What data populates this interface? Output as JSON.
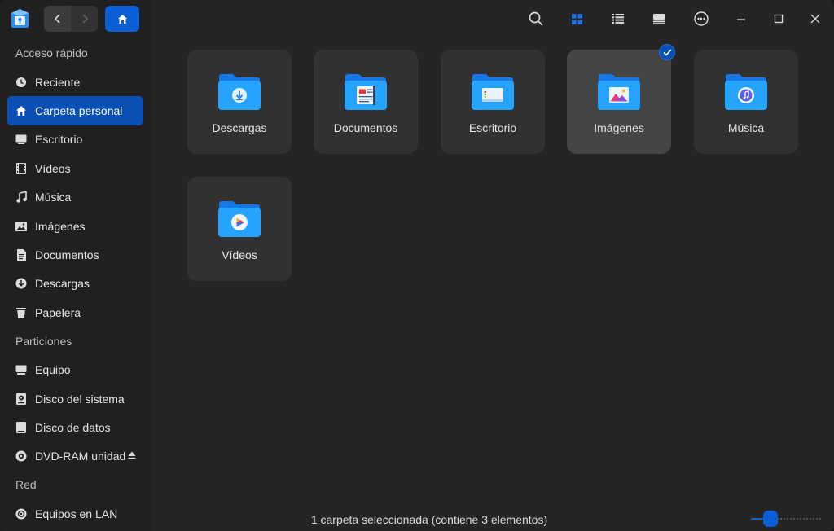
{
  "nav": {
    "back_icon": "chevron-left-icon",
    "forward_icon": "chevron-right-icon",
    "home_icon": "home-icon"
  },
  "sidebar": {
    "sections": [
      {
        "title": "Acceso rápido",
        "items": [
          {
            "label": "Reciente",
            "icon": "clock-icon"
          },
          {
            "label": "Carpeta personal",
            "icon": "home-icon",
            "active": true
          },
          {
            "label": "Escritorio",
            "icon": "desktop-icon"
          },
          {
            "label": "Vídeos",
            "icon": "film-icon"
          },
          {
            "label": "Música",
            "icon": "music-note-icon"
          },
          {
            "label": "Imágenes",
            "icon": "image-icon"
          },
          {
            "label": "Documentos",
            "icon": "document-icon"
          },
          {
            "label": "Descargas",
            "icon": "download-icon"
          },
          {
            "label": "Papelera",
            "icon": "trash-icon"
          }
        ]
      },
      {
        "title": "Particiones",
        "items": [
          {
            "label": "Equipo",
            "icon": "computer-icon"
          },
          {
            "label": "Disco del sistema",
            "icon": "disk-icon"
          },
          {
            "label": "Disco de datos",
            "icon": "disk-icon"
          },
          {
            "label": "DVD-RAM unidad",
            "icon": "disc-icon",
            "eject": true
          }
        ]
      },
      {
        "title": "Red",
        "items": [
          {
            "label": "Equipos en LAN",
            "icon": "network-icon"
          }
        ]
      }
    ]
  },
  "toolbar": {
    "search_icon": "search-icon",
    "icon_view_icon": "grid-view-icon",
    "list_view_icon": "list-view-icon",
    "detail_view_icon": "detail-view-icon",
    "more_icon": "more-options-icon",
    "minimize_icon": "minimize-icon",
    "maximize_icon": "maximize-icon",
    "close_icon": "close-icon",
    "accent": "#0a5fd6"
  },
  "folders": [
    {
      "label": "Descargas",
      "icon": "download-folder-icon"
    },
    {
      "label": "Documentos",
      "icon": "documents-folder-icon"
    },
    {
      "label": "Escritorio",
      "icon": "desktop-folder-icon"
    },
    {
      "label": "Imágenes",
      "icon": "pictures-folder-icon",
      "selected": true
    },
    {
      "label": "Música",
      "icon": "music-folder-icon"
    },
    {
      "label": "Vídeos",
      "icon": "videos-folder-icon"
    }
  ],
  "status": {
    "text": "1 carpeta seleccionada (contiene 3 elementos)"
  },
  "zoom": {
    "level": 0.22
  }
}
